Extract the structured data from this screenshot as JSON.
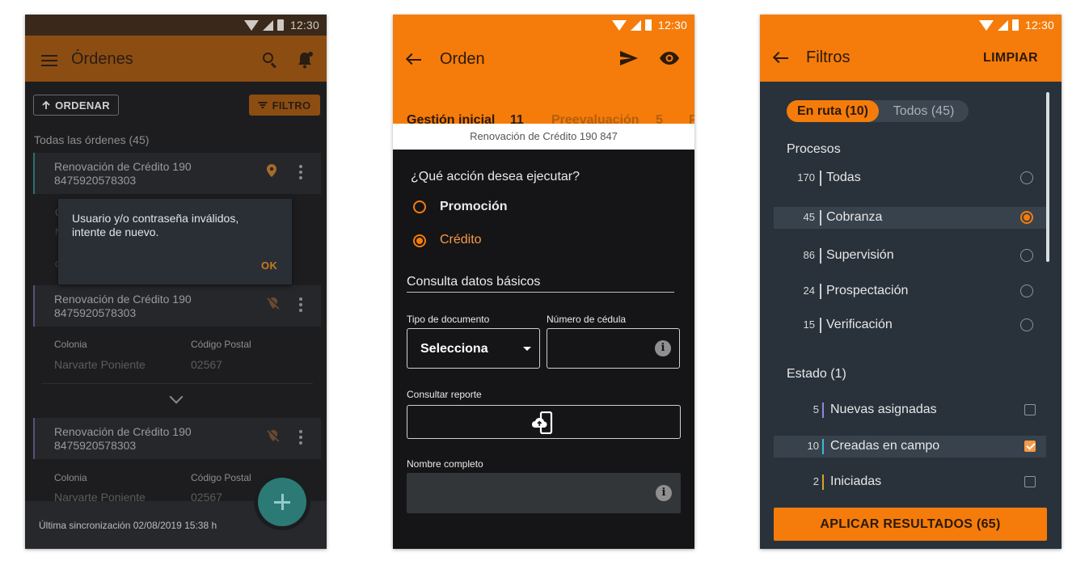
{
  "status_bar": {
    "time": "12:30"
  },
  "screen1": {
    "title": "Órdenes",
    "sort_button": "ORDENAR",
    "filter_button": "FILTRO",
    "section_label": "Todas las órdenes (45)",
    "cards": [
      {
        "title": "Renovación de Crédito 190",
        "id": "8475920578303",
        "location_status": "located"
      },
      {
        "title": "Renovación de Crédito 190",
        "id": "8475920578303",
        "location_status": "no-location",
        "colonia_label": "Colonia",
        "colonia_value": "Narvarte Poniente",
        "cp_label": "Código Postal",
        "cp_value": "02567"
      },
      {
        "title": "Renovación de Crédito 190",
        "id": "8475920578303",
        "location_status": "no-location",
        "colonia_label": "Colonia",
        "colonia_value": "Narvarte Poniente",
        "cp_label": "Código Postal",
        "cp_value": "02567"
      }
    ],
    "dialog": {
      "message": "Usuario y/o contraseña inválidos, intente de nuevo.",
      "ok": "OK"
    },
    "footer": "Última sincronización 02/08/2019 15:38 h"
  },
  "screen2": {
    "title": "Orden",
    "tabs": [
      {
        "label": "Gestión inicial",
        "count": "11",
        "active": true
      },
      {
        "label": "Preevaluación",
        "count": "5",
        "active": false
      },
      {
        "label": "P",
        "count": "",
        "active": false
      }
    ],
    "subtitle": "Renovación de Crédito 190 847",
    "question": "¿Qué acción desea ejecutar?",
    "options": [
      {
        "label": "Promoción",
        "selected": false
      },
      {
        "label": "Crédito",
        "selected": true
      }
    ],
    "section": "Consulta datos básicos",
    "doc_type_label": "Tipo de documento",
    "doc_type_value": "Selecciona",
    "id_number_label": "Número de cédula",
    "id_number_value": "",
    "report_label": "Consultar reporte",
    "fullname_label": "Nombre completo",
    "fullname_value": ""
  },
  "screen3": {
    "title": "Filtros",
    "clear": "LIMPIAR",
    "segments": {
      "active": "En ruta (10)",
      "inactive": "Todos (45)"
    },
    "processes_header": "Procesos",
    "processes": [
      {
        "count": "170",
        "name": "Todas",
        "selected": false
      },
      {
        "count": "45",
        "name": "Cobranza",
        "selected": true
      },
      {
        "count": "86",
        "name": "Supervisión",
        "selected": false
      },
      {
        "count": "24",
        "name": "Prospectación",
        "selected": false
      },
      {
        "count": "15",
        "name": "Verificación",
        "selected": false
      }
    ],
    "state_header": "Estado (1)",
    "states": [
      {
        "count": "5",
        "name": "Nuevas asignadas",
        "color": "#8e86e0",
        "checked": false
      },
      {
        "count": "10",
        "name": "Creadas en campo",
        "color": "#3fb8d6",
        "checked": true
      },
      {
        "count": "2",
        "name": "Iniciadas",
        "color": "#d9a12a",
        "checked": false
      }
    ],
    "apply_button": "APLICAR RESULTADOS (65)"
  },
  "colors": {
    "accent": "#f57c0a",
    "accent_dim": "#8c4d13",
    "teal": "#2b7a76"
  }
}
